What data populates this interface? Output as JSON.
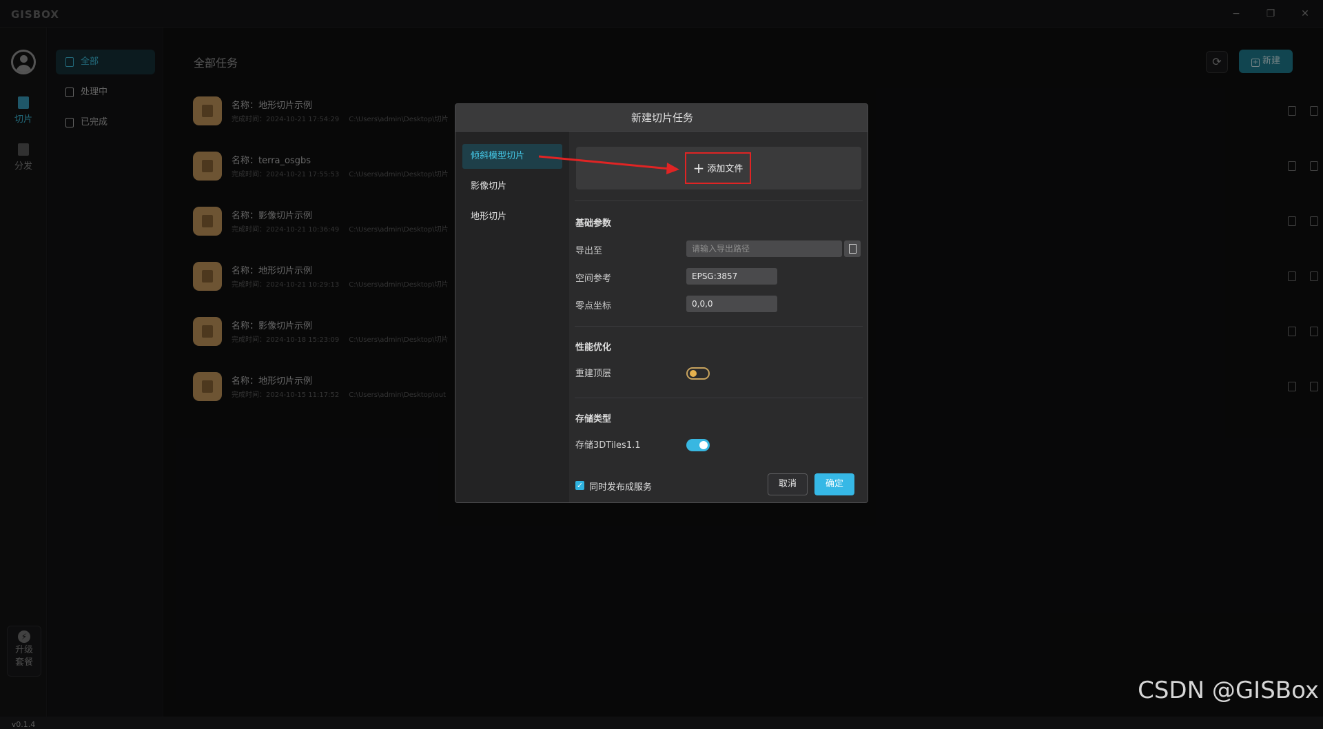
{
  "app": {
    "logo": "GISBOX",
    "version": "v0.1.4"
  },
  "window": {
    "minimize": "−",
    "restore": "❐",
    "close": "✕"
  },
  "rail": {
    "items": [
      {
        "label": "切片",
        "icon": "slice-icon",
        "active": true
      },
      {
        "label": "分发",
        "icon": "distribute-icon",
        "active": false
      }
    ],
    "upgrade": {
      "line1": "升级",
      "line2": "套餐",
      "icon": "bolt-icon"
    }
  },
  "sidebar": {
    "items": [
      {
        "label": "全部",
        "active": true
      },
      {
        "label": "处理中",
        "active": false
      },
      {
        "label": "已完成",
        "active": false
      }
    ]
  },
  "main": {
    "title": "全部任务",
    "new_button": "新建",
    "tasks": [
      {
        "name": "名称：地形切片示例",
        "time": "完成时间：2024-10-21 17:54:29",
        "path": "C:\\Users\\admin\\Desktop\\切片"
      },
      {
        "name": "名称：terra_osgbs",
        "time": "完成时间：2024-10-21 17:55:53",
        "path": "C:\\Users\\admin\\Desktop\\切片"
      },
      {
        "name": "名称：影像切片示例",
        "time": "完成时间：2024-10-21 10:36:49",
        "path": "C:\\Users\\admin\\Desktop\\切片"
      },
      {
        "name": "名称：地形切片示例",
        "time": "完成时间：2024-10-21 10:29:13",
        "path": "C:\\Users\\admin\\Desktop\\切片"
      },
      {
        "name": "名称：影像切片示例",
        "time": "完成时间：2024-10-18 15:23:09",
        "path": "C:\\Users\\admin\\Desktop\\切片"
      },
      {
        "name": "名称：地形切片示例",
        "time": "完成时间：2024-10-15 11:17:52",
        "path": "C:\\Users\\admin\\Desktop\\out"
      }
    ]
  },
  "dialog": {
    "title": "新建切片任务",
    "nav": [
      "倾斜模型切片",
      "影像切片",
      "地形切片"
    ],
    "add_file": "添加文件",
    "basic_section": "基础参数",
    "export_label": "导出至",
    "export_placeholder": "请输入导出路径",
    "srs_label": "空间参考",
    "srs_value": "EPSG:3857",
    "origin_label": "零点坐标",
    "origin_value": "0,0,0",
    "perf_section": "性能优化",
    "rebuild_label": "重建顶层",
    "rebuild_on": false,
    "storage_section": "存储类型",
    "tiles_label": "存储3DTiles1.1",
    "tiles_on": true,
    "publish_label": "同时发布成服务",
    "publish_checked": true,
    "cancel": "取消",
    "ok": "确定"
  },
  "colors": {
    "accent": "#36b8e6",
    "highlight": "#e02424",
    "thumb": "#c79a5d"
  },
  "watermark": "CSDN @GISBox"
}
